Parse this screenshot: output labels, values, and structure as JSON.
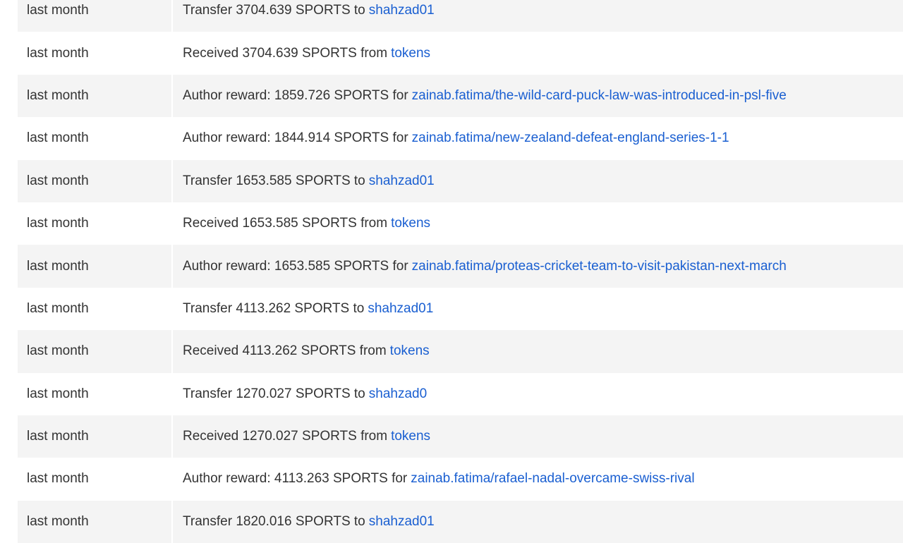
{
  "rows": [
    {
      "time": "last month",
      "text": "Transfer 3704.639 SPORTS to",
      "link": "shahzad01"
    },
    {
      "time": "last month",
      "text": "Received 3704.639 SPORTS from",
      "link": "tokens"
    },
    {
      "time": "last month",
      "text": "Author reward: 1859.726 SPORTS for",
      "link": "zainab.fatima/the-wild-card-puck-law-was-introduced-in-psl-five"
    },
    {
      "time": "last month",
      "text": "Author reward: 1844.914 SPORTS for",
      "link": "zainab.fatima/new-zealand-defeat-england-series-1-1"
    },
    {
      "time": "last month",
      "text": "Transfer 1653.585 SPORTS to",
      "link": "shahzad01"
    },
    {
      "time": "last month",
      "text": "Received 1653.585 SPORTS from",
      "link": "tokens"
    },
    {
      "time": "last month",
      "text": "Author reward: 1653.585 SPORTS for",
      "link": "zainab.fatima/proteas-cricket-team-to-visit-pakistan-next-march"
    },
    {
      "time": "last month",
      "text": "Transfer 4113.262 SPORTS to",
      "link": "shahzad01"
    },
    {
      "time": "last month",
      "text": "Received 4113.262 SPORTS from",
      "link": "tokens"
    },
    {
      "time": "last month",
      "text": "Transfer 1270.027 SPORTS to",
      "link": "shahzad0"
    },
    {
      "time": "last month",
      "text": "Received 1270.027 SPORTS from",
      "link": "tokens"
    },
    {
      "time": "last month",
      "text": "Author reward: 4113.263 SPORTS for",
      "link": "zainab.fatima/rafael-nadal-overcame-swiss-rival"
    },
    {
      "time": "last month",
      "text": "Transfer 1820.016 SPORTS to",
      "link": "shahzad01"
    }
  ]
}
